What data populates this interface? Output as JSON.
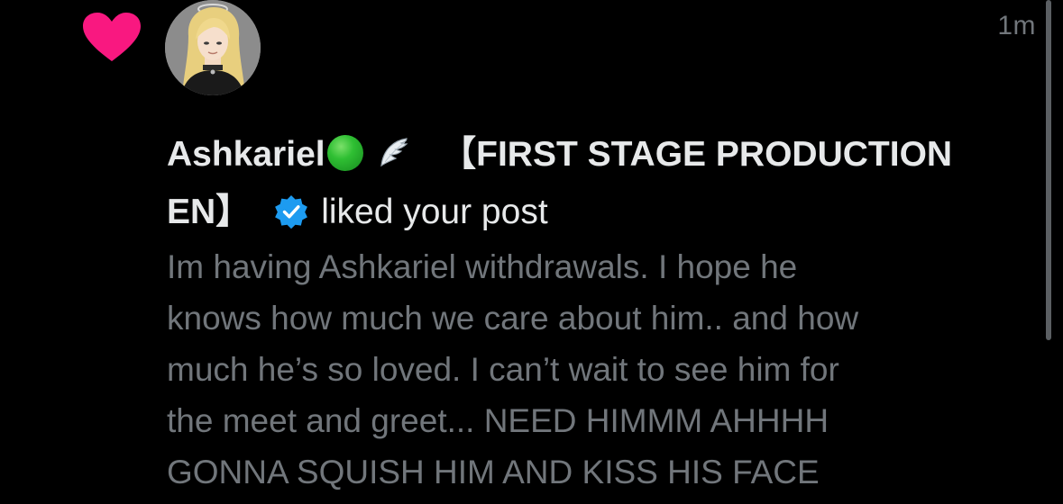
{
  "notification": {
    "type_icon": "heart-icon",
    "accent_color": "#f91880",
    "avatar_icon": "avatar",
    "timestamp": "1m",
    "user": {
      "name": "Ashkariel",
      "emoji_1": "green-circle-icon",
      "emoji_2": "wing-icon",
      "display_suffix_line1": "【FIRST STAGE PRODUCTION",
      "display_suffix_line2": "EN】",
      "verified_icon": "verified-badge-icon",
      "verified_color": "#1d9bf0"
    },
    "action_text": "liked your post",
    "post_text": "Im having Ashkariel withdrawals. I hope he\nknows how much we care about him.. and how\nmuch he’s so loved. I can’t wait to see him for\nthe meet and greet...  NEED HIMMM AHHHH\nGONNA SQUISH HIM AND KISS HIS FACE"
  },
  "colors": {
    "background": "#000000",
    "primary_text": "#e7e9ea",
    "secondary_text": "#71767b",
    "scrollbar": "#5b5f63"
  }
}
